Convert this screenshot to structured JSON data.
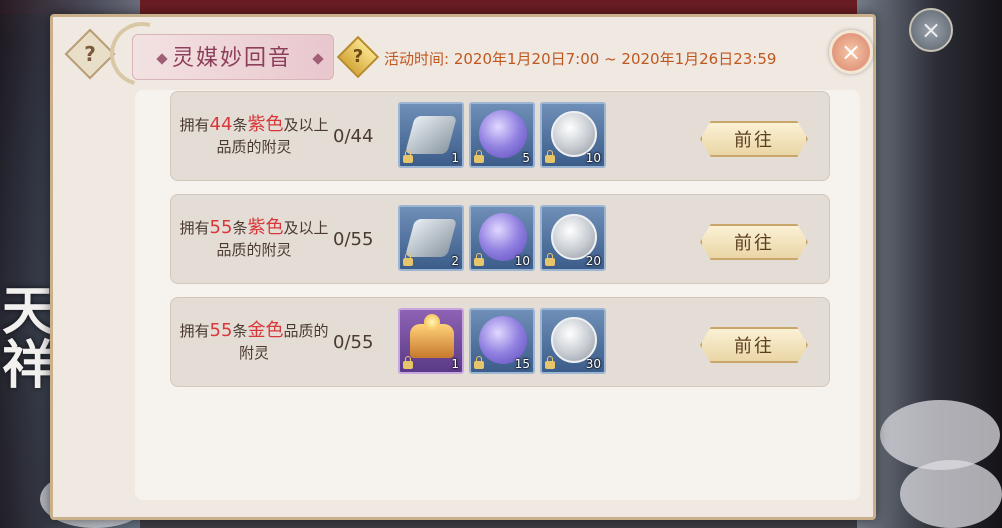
{
  "event": {
    "title": "灵媒妙回音",
    "time_label": "活动时间: 2020年1月20日7:00 ~ 2020年1月26日23:59",
    "help_glyph": "?",
    "close_glyph": "×"
  },
  "background": {
    "calligraphy": "天降祥瑞"
  },
  "colors": {
    "highlight_red": "#d8383a",
    "time_orange": "#c0571e",
    "title_pink": "#8b3f5a"
  },
  "tasks": [
    {
      "desc_pre": "拥有",
      "count": "44",
      "desc_mid": "条",
      "quality": "紫色",
      "desc_post": "及以上品质的附灵",
      "progress": "0/44",
      "go_label": "前往",
      "rewards": [
        {
          "icon": "silver-gem-icon",
          "qty": "1"
        },
        {
          "icon": "spirit-orb-icon",
          "qty": "5"
        },
        {
          "icon": "silver-coin-icon",
          "qty": "10"
        }
      ]
    },
    {
      "desc_pre": "拥有",
      "count": "55",
      "desc_mid": "条",
      "quality": "紫色",
      "desc_post": "及以上品质的附灵",
      "progress": "0/55",
      "go_label": "前往",
      "rewards": [
        {
          "icon": "silver-gem-icon",
          "qty": "2"
        },
        {
          "icon": "spirit-orb-icon",
          "qty": "10"
        },
        {
          "icon": "silver-coin-icon",
          "qty": "20"
        }
      ]
    },
    {
      "desc_pre": "拥有",
      "count": "55",
      "desc_mid": "条",
      "quality": "金色",
      "desc_post": "品质的附灵",
      "progress": "0/55",
      "go_label": "前往",
      "rewards": [
        {
          "icon": "golden-chest-icon",
          "qty": "1"
        },
        {
          "icon": "spirit-orb-icon",
          "qty": "15"
        },
        {
          "icon": "silver-coin-icon",
          "qty": "30"
        }
      ]
    }
  ]
}
